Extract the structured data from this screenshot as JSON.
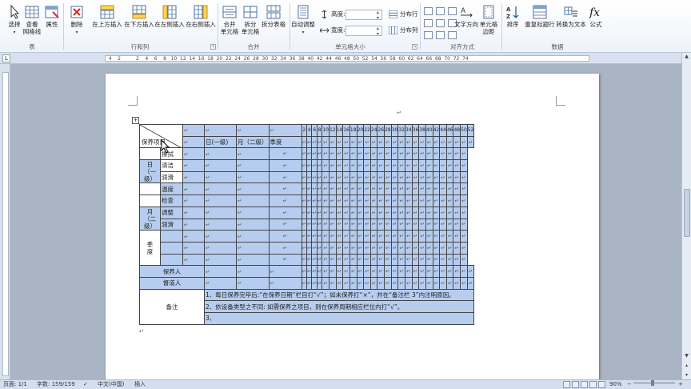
{
  "ribbon": {
    "buttons": {
      "select": "选择",
      "view_gridlines": "查看\n网格线",
      "properties": "属性",
      "delete": "删除",
      "insert_above": "在上方插入",
      "insert_below": "在下方插入",
      "insert_left": "在左侧插入",
      "insert_right": "在右侧插入",
      "merge_cells": "合并\n单元格",
      "split_cells": "拆分\n单元格",
      "split_table": "拆分表格",
      "autofit": "自动调整",
      "height_label": "高度:",
      "width_label": "宽度:",
      "distribute_rows": "分布行",
      "distribute_cols": "分布列",
      "text_direction": "文字方向",
      "cell_margins": "单元格\n边距",
      "sort": "排序",
      "repeat_header": "重复标题行",
      "convert_to_text": "转换为文本",
      "formula": "公式"
    },
    "groups": {
      "table": "表",
      "rows_cols": "行和列",
      "merge": "合并",
      "cell_size": "单元格大小",
      "alignment": "对齐方式",
      "data": "数据"
    }
  },
  "ruler": {
    "marks": [
      "4",
      "2",
      "",
      "2",
      "4",
      "6",
      "8",
      "10",
      "12",
      "14",
      "16",
      "18",
      "20",
      "22",
      "24",
      "26",
      "28",
      "30",
      "32",
      "34",
      "36",
      "38",
      "40",
      "42",
      "44",
      "46",
      "48",
      "50",
      "52",
      "54",
      "56",
      "58",
      "60",
      "62",
      "64",
      "66",
      "68",
      "70",
      "72",
      "74"
    ]
  },
  "document": {
    "para_mark": "↵",
    "table": {
      "header_top": {
        "day": "日(一级)",
        "month": "月（二级）",
        "quarter": "季度",
        "col_numbers": [
          "2",
          "4",
          "6",
          "8",
          "10",
          "12",
          "14",
          "16",
          "18",
          "20",
          "22",
          "24",
          "26",
          "28",
          "30",
          "32",
          "34",
          "36",
          "38",
          "40",
          "42",
          "44",
          "46",
          "48",
          "50",
          "52"
        ]
      },
      "corner_label": "保养项目",
      "day_group": "日\n（一级）",
      "month_group": "月\n（二级）",
      "quarter_group": "季\n度",
      "items": [
        "擦拭",
        "清洁",
        "润滑",
        "温度",
        "检查",
        "调整",
        "润滑"
      ],
      "maintainer": "保养人",
      "supervisor": "督道人",
      "remarks": "备注",
      "note1": "1、每日保养完毕后:“在保养日期”栏目打“√”；如未保养打“×”，并在“备注栏 3”内注明原因。",
      "note2": "2、依设备类型之不同: 如需保养之项目，则在保养周期相应栏位内打“√”。",
      "note3": "3、"
    }
  },
  "status": {
    "page": "页面: 1/1",
    "words": "字数: 159/159",
    "lang": "中文(中国)",
    "mode": "插入",
    "zoom": "90%"
  }
}
